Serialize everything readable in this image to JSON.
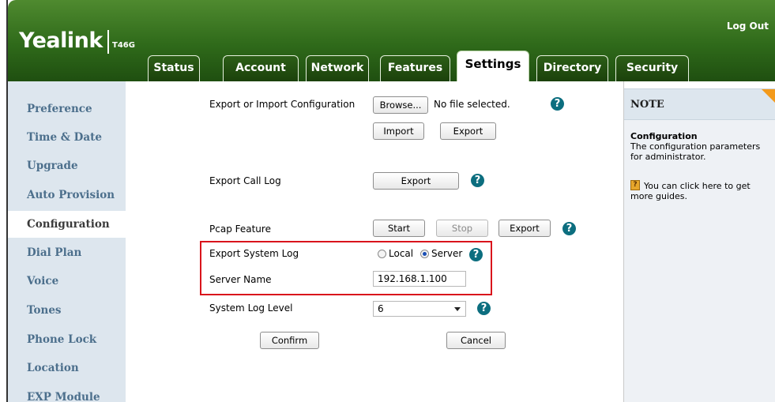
{
  "header": {
    "logo": "Yealink",
    "model": "T46G",
    "logout": "Log Out",
    "tabs": [
      {
        "label": "Status"
      },
      {
        "label": "Account"
      },
      {
        "label": "Network"
      },
      {
        "label": "Features"
      },
      {
        "label": "Settings",
        "active": true
      },
      {
        "label": "Directory"
      },
      {
        "label": "Security"
      }
    ]
  },
  "sidebar": {
    "items": [
      {
        "label": "Preference"
      },
      {
        "label": "Time & Date"
      },
      {
        "label": "Upgrade"
      },
      {
        "label": "Auto Provision"
      },
      {
        "label": "Configuration",
        "active": true
      },
      {
        "label": "Dial Plan"
      },
      {
        "label": "Voice"
      },
      {
        "label": "Tones"
      },
      {
        "label": "Phone Lock"
      },
      {
        "label": "Location"
      },
      {
        "label": "EXP Module"
      }
    ]
  },
  "main": {
    "export_import": {
      "label": "Export or Import Configuration",
      "browse": "Browse...",
      "file_status": "No file selected.",
      "import": "Import",
      "export": "Export"
    },
    "call_log": {
      "label": "Export Call Log",
      "export": "Export"
    },
    "pcap": {
      "label": "Pcap Feature",
      "start": "Start",
      "stop": "Stop",
      "export": "Export"
    },
    "system_log": {
      "label": "Export System Log",
      "local": "Local",
      "server": "Server",
      "selected": "Server"
    },
    "server_name": {
      "label": "Server Name",
      "value": "192.168.1.100"
    },
    "log_level": {
      "label": "System Log Level",
      "value": "6"
    },
    "confirm": "Confirm",
    "cancel": "Cancel",
    "help_glyph": "?"
  },
  "note": {
    "title": "NOTE",
    "subtitle": "Configuration",
    "description": "The configuration parameters for administrator.",
    "guide": "You can click here to get more guides.",
    "guide_icon": "?"
  },
  "colors": {
    "header_green": "#2f6a1a",
    "sidebar_bg": "#dde6ee",
    "sidebar_text": "#4c6f8c",
    "help_icon": "#0c6e7f",
    "highlight_red": "#d9141c",
    "note_corner": "#f39a1b"
  }
}
